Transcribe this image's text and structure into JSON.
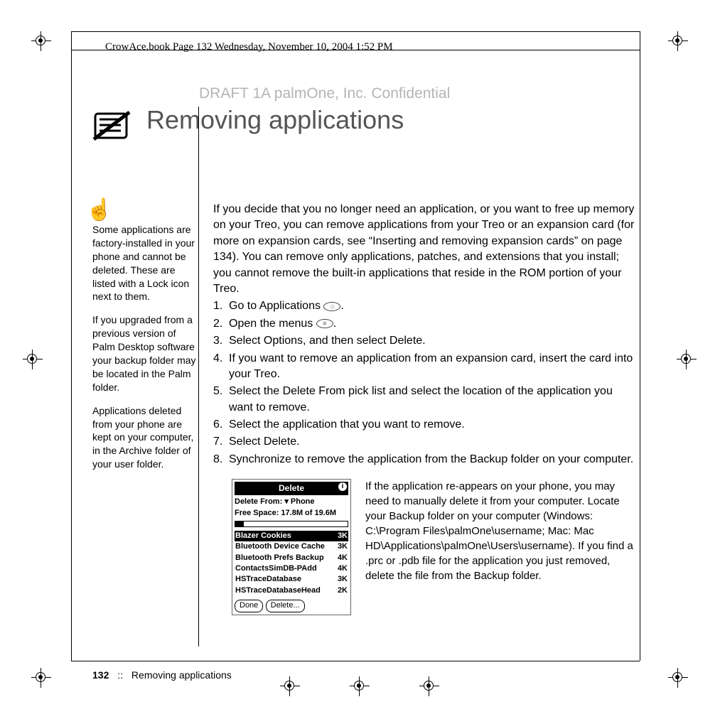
{
  "book_header": "CrowAce.book  Page 132  Wednesday, November 10, 2004  1:52 PM",
  "draft": "DRAFT 1A  palmOne, Inc.   Confidential",
  "heading": "Removing applications",
  "sidebar": {
    "p1": "Some applications are factory-installed in your phone and cannot be deleted. These are listed with a Lock icon next to them.",
    "p2": "If you upgraded from a previous version of Palm Desktop software your backup folder may be located in the Palm folder.",
    "p3": "Applications deleted from your phone are kept on your computer, in the Archive folder of your user folder."
  },
  "intro": "If you decide that you no longer need an application, or you want to free up memory on your Treo, you can remove applications from your Treo or an expansion card (for more on expansion cards, see “Inserting and removing expansion cards” on page 134). You can remove only applications, patches, and extensions that you install; you cannot remove the built-in applications that reside in the ROM portion of your Treo.",
  "steps": [
    "Go to Applications ",
    "Open the menus ",
    "Select Options, and then select Delete.",
    "If you want to remove an application from an expansion card, insert the card into your Treo.",
    "Select the Delete From pick list and select the location of the application you want to remove.",
    "Select the application that you want to remove.",
    "Select Delete.",
    "Synchronize to remove the application from the Backup folder on your computer."
  ],
  "step_suffix": ".",
  "dialog": {
    "title": "Delete",
    "from_label": "Delete From:",
    "from_value": "Phone",
    "free_label": "Free Space: 17.8M of 19.6M",
    "items": [
      {
        "name": "Blazer Cookies",
        "size": "3K",
        "sel": true
      },
      {
        "name": "Bluetooth Device Cache",
        "size": "3K"
      },
      {
        "name": "Bluetooth Prefs Backup",
        "size": "4K"
      },
      {
        "name": "ContactsSimDB-PAdd",
        "size": "4K"
      },
      {
        "name": "HSTraceDatabase",
        "size": "3K"
      },
      {
        "name": "HSTraceDatabaseHead",
        "size": "2K"
      }
    ],
    "btn_done": "Done",
    "btn_delete": "Delete..."
  },
  "below": "If the application re-appears on your phone, you may need to manually delete it from your computer. Locate your Backup folder on your computer (Windows: C:\\Program Files\\palmOne\\username; Mac: Mac HD\\Applications\\palmOne\\Users\\username). If you find a .prc or .pdb file for the application you just removed, delete the file from the Backup folder.",
  "footer": {
    "page": "132",
    "sep": "::",
    "title": "Removing applications"
  }
}
